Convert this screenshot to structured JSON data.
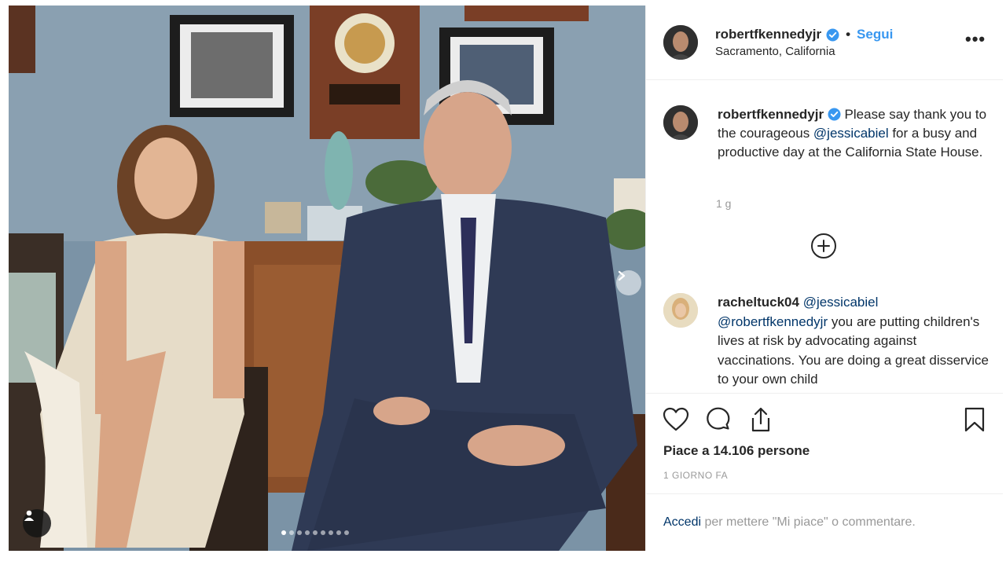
{
  "post": {
    "username": "robertfkennedyjr",
    "verified": true,
    "separator": "•",
    "follow_label": "Segui",
    "location": "Sacramento, California",
    "more_icon": "more-options-icon",
    "more_label": "•••"
  },
  "caption": {
    "username": "robertfkennedyjr",
    "text_part1": " Please say thank you to the courageous ",
    "mention": "@jessicabiel",
    "text_part2": " for a busy and productive day at the California State House.",
    "time": "1 g"
  },
  "comment": {
    "username": "racheltuck04",
    "mention1": "@jessicabiel",
    "mention2": "@robertfkennedyjr",
    "text": " you are putting children's lives at risk by advocating against vaccinations. You are doing a great disservice to your own child"
  },
  "photo": {
    "carousel_dots": 9,
    "active_dot": 0
  },
  "actions": {
    "likes_text": "Piace a 14.106 persone",
    "time_text": "1 GIORNO FA",
    "login_link": "Accedi",
    "login_rest": " per mettere \"Mi piace\" o commentare."
  },
  "colors": {
    "accent": "#3897f0",
    "link": "#003569",
    "muted": "#999999",
    "text": "#262626"
  }
}
